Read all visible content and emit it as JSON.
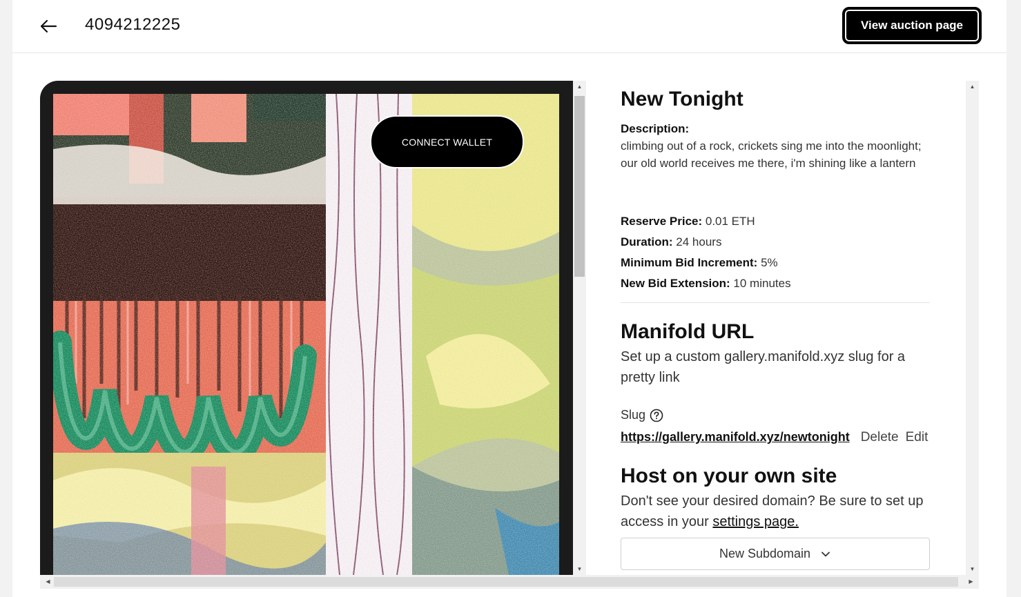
{
  "header": {
    "title": "4094212225",
    "view_auction_label": "View auction page"
  },
  "preview": {
    "connect_wallet_label": "CONNECT WALLET"
  },
  "details": {
    "heading": "New Tonight",
    "description_label": "Description:",
    "description_text": "climbing out of a rock, crickets sing me into the moonlight; our old world receives me there, i'm shining like a lantern",
    "fields": [
      {
        "label": "Reserve Price:",
        "value": "0.01 ETH"
      },
      {
        "label": "Duration:",
        "value": "24 hours"
      },
      {
        "label": "Minimum Bid Increment:",
        "value": "5%"
      },
      {
        "label": "New Bid Extension:",
        "value": "10 minutes"
      }
    ],
    "manifold_heading": "Manifold URL",
    "manifold_sub": "Set up a custom gallery.manifold.xyz slug for a pretty link",
    "slug_label": "Slug",
    "slug_url": "https://gallery.manifold.xyz/newtonight",
    "delete_label": "Delete",
    "edit_label": "Edit",
    "host_heading": "Host on your own site",
    "host_text": "Don't see your desired domain? Be sure to set up access in your",
    "settings_link": "settings page.",
    "subdomain_select": "New Subdomain"
  },
  "icons": {
    "back": "arrow-left-icon",
    "help": "question-circle-icon",
    "chevron": "chevron-down-icon"
  }
}
